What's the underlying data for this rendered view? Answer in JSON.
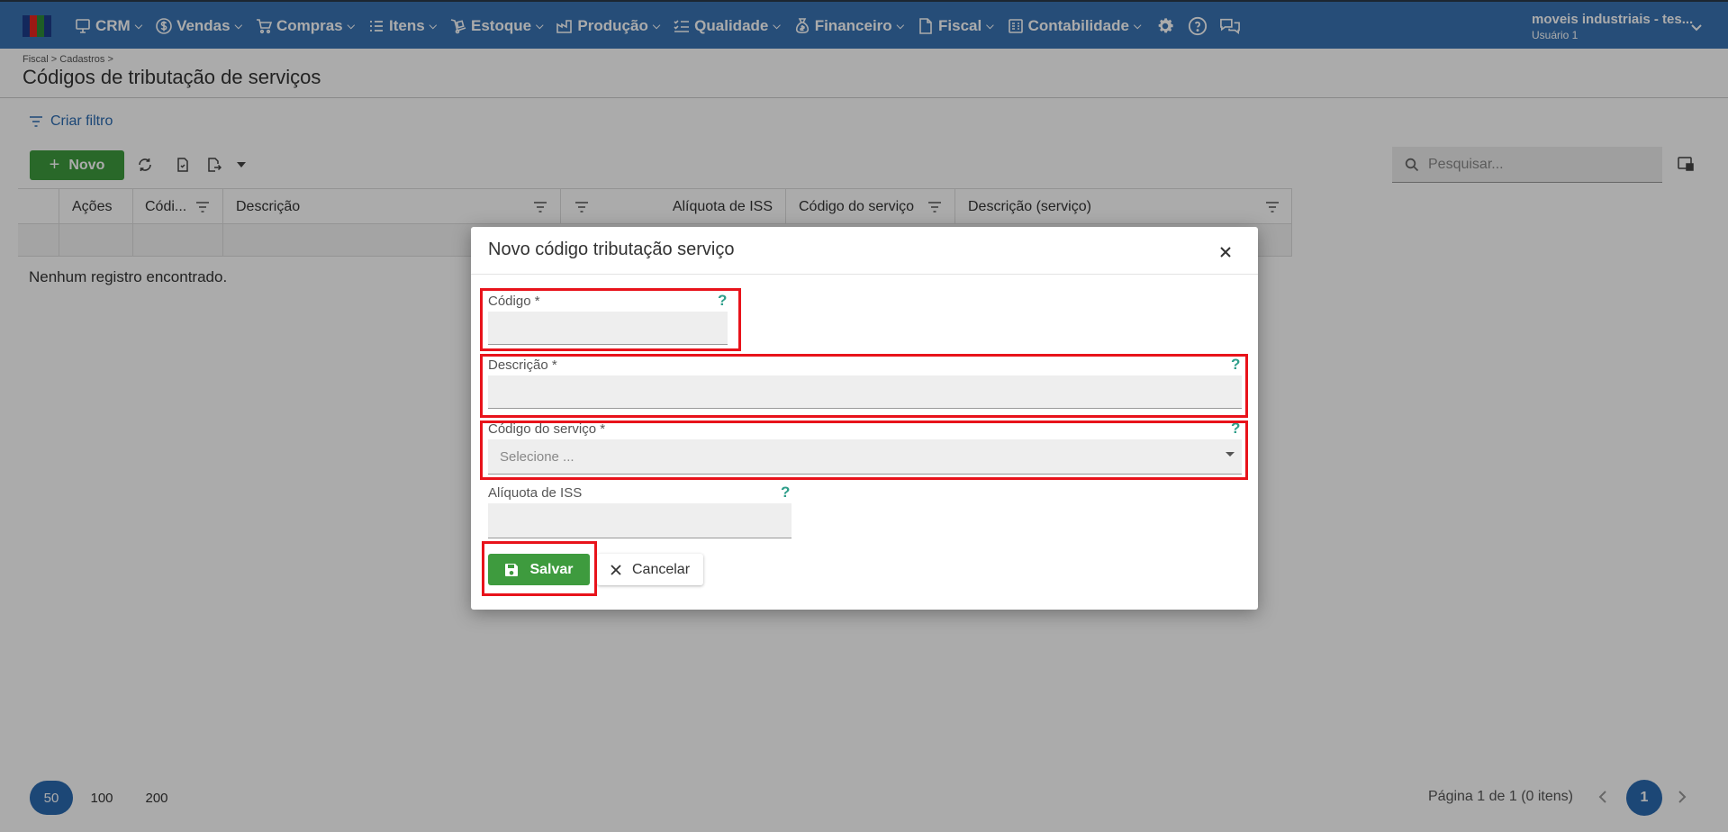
{
  "nav": {
    "logo_colors": [
      "#1d3d8a",
      "#e8261e",
      "#2e8b3a",
      "#1d3d8a"
    ],
    "menu": [
      {
        "label": "CRM",
        "icon": "crm-icon"
      },
      {
        "label": "Vendas",
        "icon": "dollar-circle-icon"
      },
      {
        "label": "Compras",
        "icon": "cart-icon"
      },
      {
        "label": "Itens",
        "icon": "list-icon"
      },
      {
        "label": "Estoque",
        "icon": "dolly-icon"
      },
      {
        "label": "Produção",
        "icon": "factory-icon"
      },
      {
        "label": "Qualidade",
        "icon": "checklist-icon"
      },
      {
        "label": "Financeiro",
        "icon": "money-bag-icon"
      },
      {
        "label": "Fiscal",
        "icon": "document-icon"
      },
      {
        "label": "Contabilidade",
        "icon": "ledger-icon"
      }
    ],
    "user": {
      "company": "moveis industriais - tes...",
      "name": "Usuário 1"
    }
  },
  "page": {
    "breadcrumb": "Fiscal > Cadastros >",
    "title": "Códigos de tributação de serviços",
    "filter_link": "Criar filtro",
    "new_button": "Novo",
    "search_placeholder": "Pesquisar..."
  },
  "grid": {
    "columns": [
      "Ações",
      "Códi...",
      "Descrição",
      "Alíquota de ISS",
      "Código do serviço",
      "Descrição (serviço)"
    ],
    "empty_message": "Nenhum registro encontrado."
  },
  "pager": {
    "sizes": [
      "50",
      "100",
      "200"
    ],
    "active_size": "50",
    "info": "Página 1 de 1 (0 itens)",
    "current_page": "1"
  },
  "modal": {
    "title": "Novo código tributação serviço",
    "fields": {
      "codigo": {
        "label": "Código *",
        "value": ""
      },
      "descricao": {
        "label": "Descrição *",
        "value": ""
      },
      "codigo_servico": {
        "label": "Código do serviço *",
        "placeholder": "Selecione ..."
      },
      "aliquota": {
        "label": "Alíquota de ISS",
        "value": ""
      }
    },
    "help_mark": "?",
    "save_label": "Salvar",
    "cancel_label": "Cancelar"
  },
  "colors": {
    "topbar": "#3a74b3",
    "primary_blue": "#2a6ab1",
    "success_green": "#3e9b3e",
    "highlight_red": "#e8131b",
    "help_teal": "#2e9e8a"
  }
}
